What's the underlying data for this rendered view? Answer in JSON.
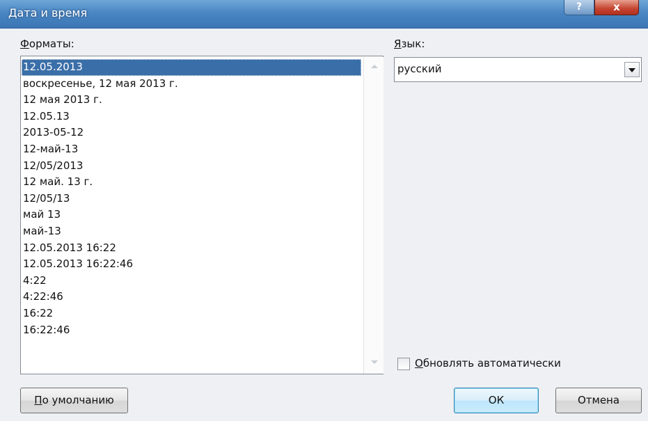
{
  "window": {
    "title": "Дата и время",
    "help_label": "?",
    "close_label": "x"
  },
  "formats": {
    "label_prefix": "Ф",
    "label_rest": "орматы:",
    "items": [
      "12.05.2013",
      "воскресенье, 12 мая 2013 г.",
      "12 мая 2013 г.",
      "12.05.13",
      "2013-05-12",
      "12-май-13",
      "12/05/2013",
      "12 май. 13 г.",
      "12/05/13",
      "май 13",
      "май-13",
      "12.05.2013 16:22",
      "12.05.2013 16:22:46",
      "4:22",
      "4:22:46",
      "16:22",
      "16:22:46"
    ],
    "selected_index": 0
  },
  "language": {
    "label_prefix": "Я",
    "label_rest": "зык:",
    "value": "русский"
  },
  "auto_update": {
    "label_prefix": "О",
    "label_rest": "бновлять автоматически",
    "checked": false
  },
  "buttons": {
    "default_prefix": "П",
    "default_rest": "о умолчанию",
    "ok": "ОК",
    "cancel": "Отмена"
  },
  "colors": {
    "selection": "#3a6ea8",
    "titlebar": "#4a86c3",
    "close": "#c4432f"
  }
}
